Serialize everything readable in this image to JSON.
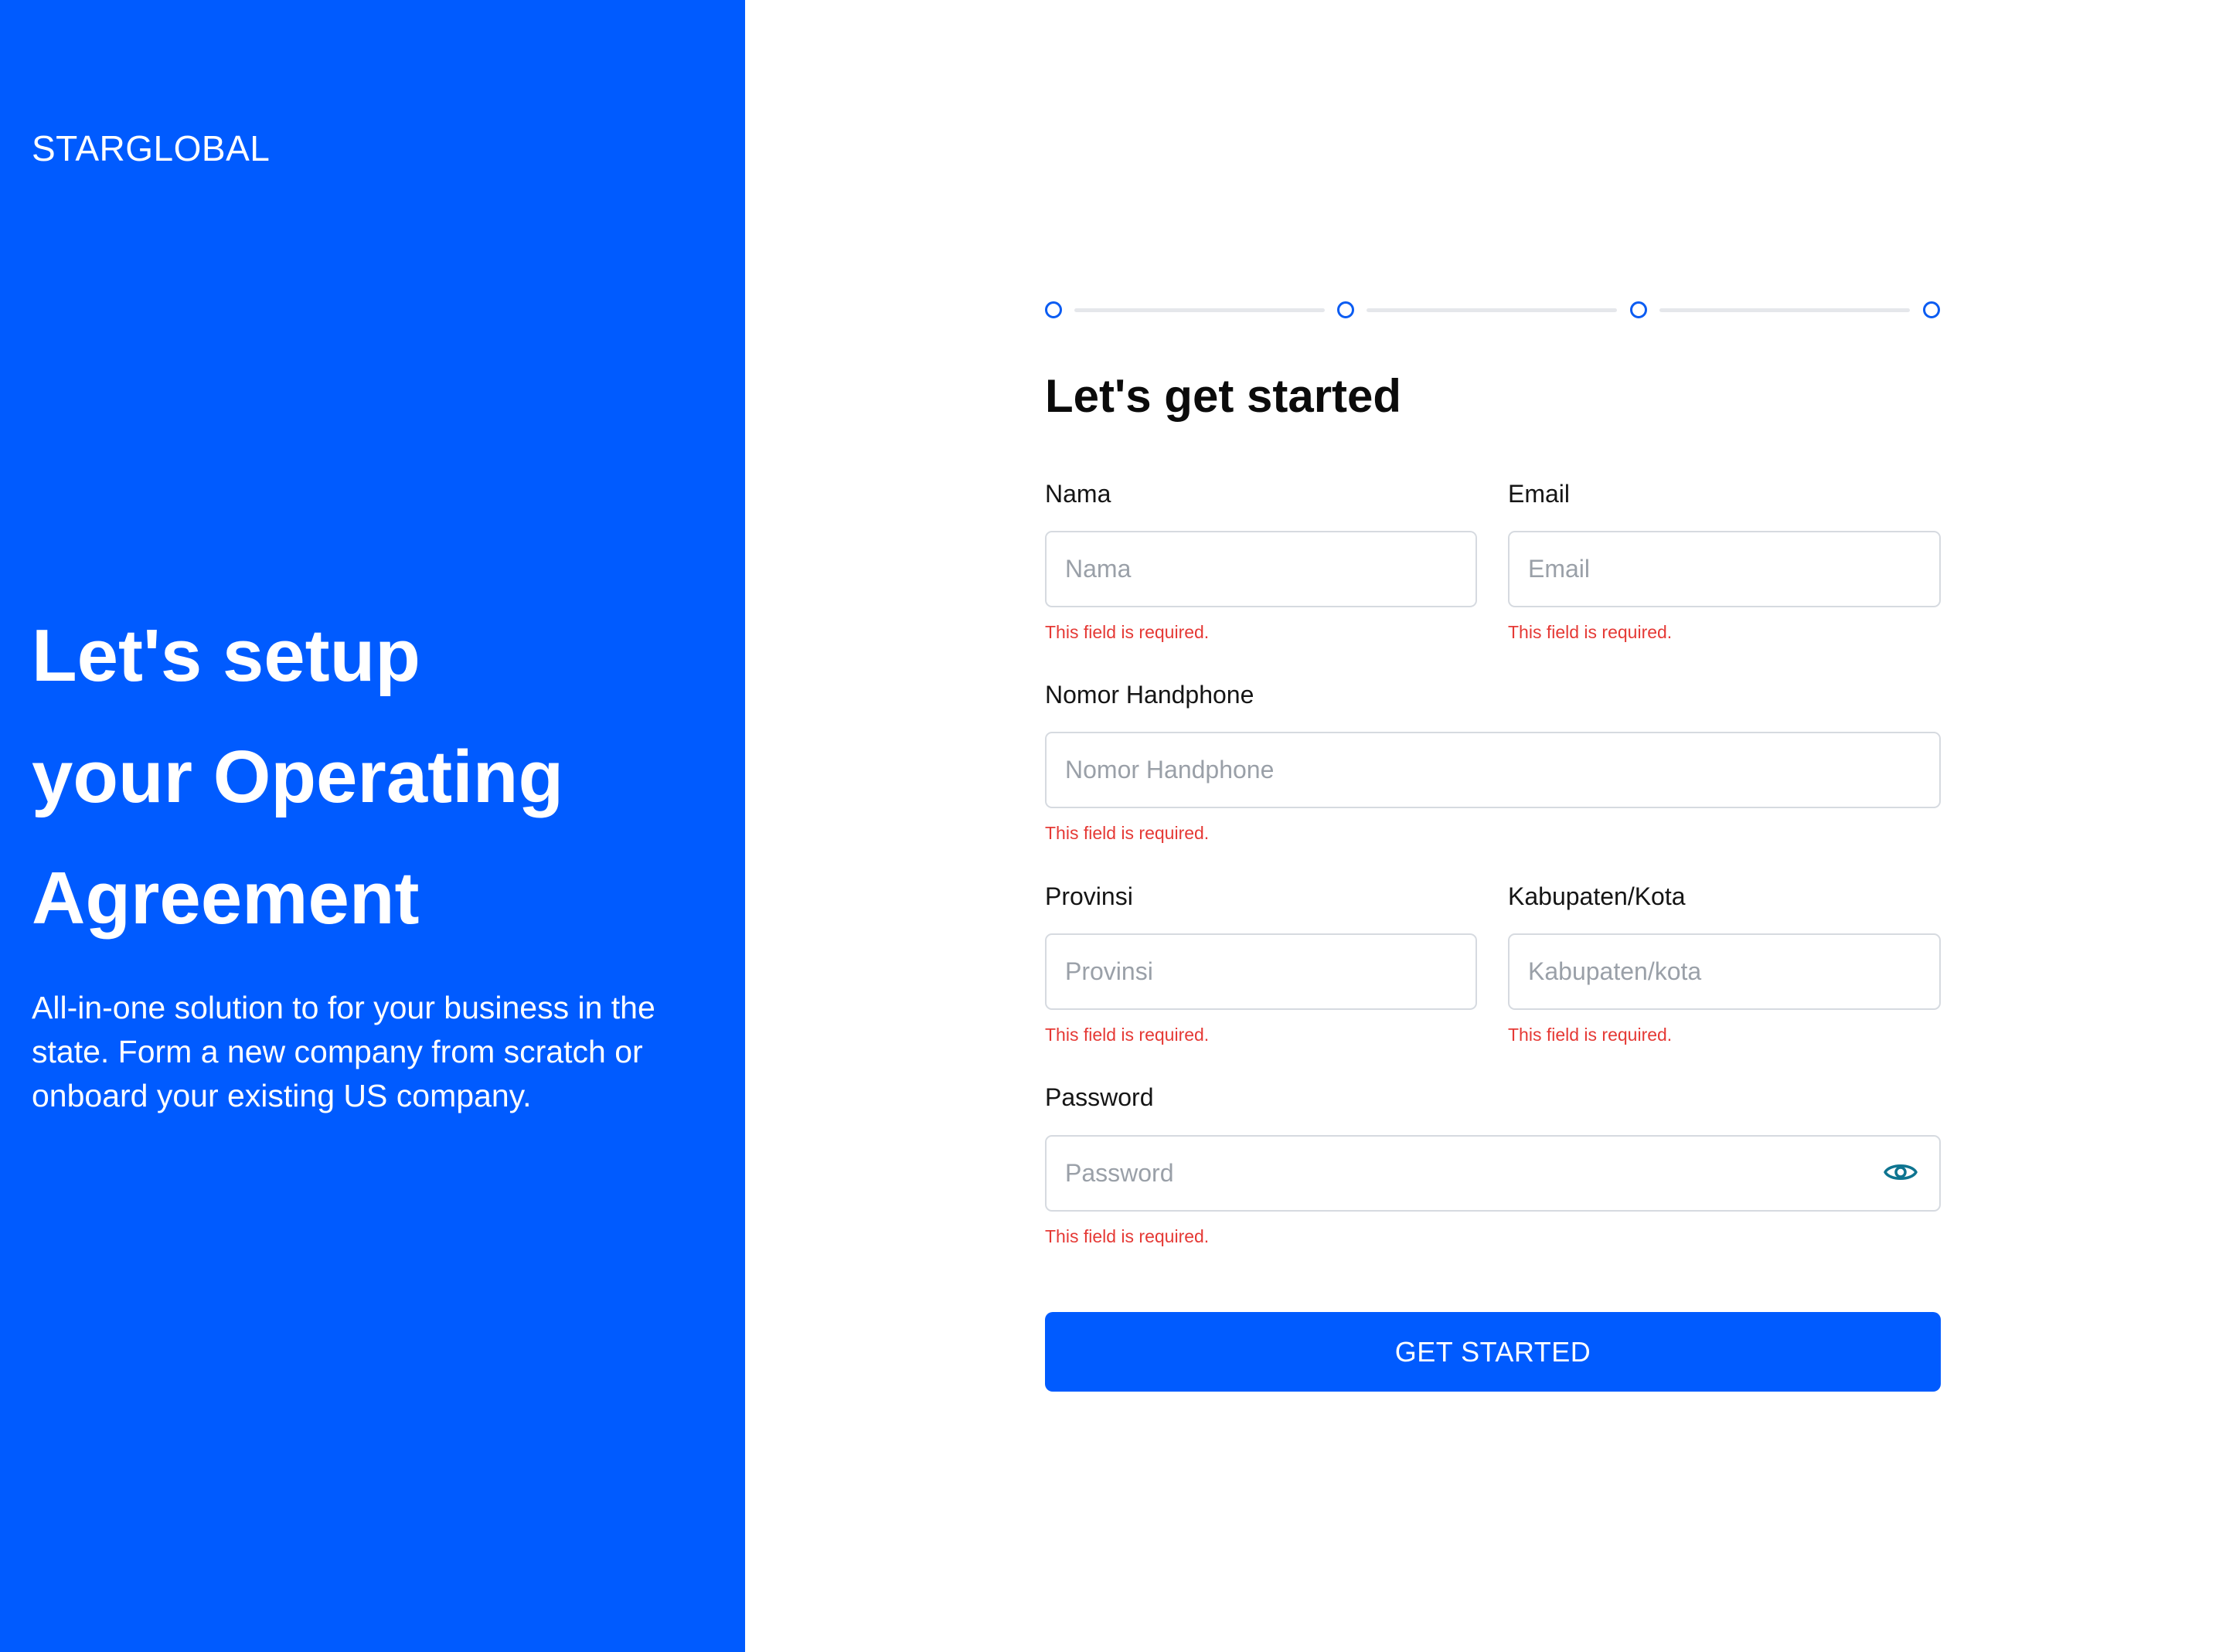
{
  "brand": {
    "name": "STARGLOBAL"
  },
  "hero": {
    "title_lines": [
      "Let's setup",
      "your Operating",
      "Agreement"
    ],
    "description": "All-in-one solution to for your business in the state. Form a new company from scratch or onboard your existing US company."
  },
  "stepper": {
    "total_steps": 4
  },
  "form": {
    "title": "Let's get started",
    "fields": {
      "nama": {
        "label": "Nama",
        "placeholder": "Nama",
        "value": "",
        "error": "This field is required."
      },
      "email": {
        "label": "Email",
        "placeholder": "Email",
        "value": "",
        "error": "This field is required."
      },
      "phone": {
        "label": "Nomor Handphone",
        "placeholder": "Nomor Handphone",
        "value": "",
        "error": "This field is required."
      },
      "provinsi": {
        "label": "Provinsi",
        "placeholder": "Provinsi",
        "value": "",
        "error": "This field is required."
      },
      "kabupaten": {
        "label": "Kabupaten/Kota",
        "placeholder": "Kabupaten/kota",
        "value": "",
        "error": "This field is required."
      },
      "password": {
        "label": "Password",
        "placeholder": "Password",
        "value": "",
        "error": "This field is required.",
        "toggle_icon": "eye-icon"
      }
    },
    "submit_label": "GET STARTED"
  },
  "colors": {
    "brand_blue": "#005bff",
    "step_blue": "#0b5cf2",
    "error_red": "#e53935",
    "eye_icon": "#0e7490"
  }
}
